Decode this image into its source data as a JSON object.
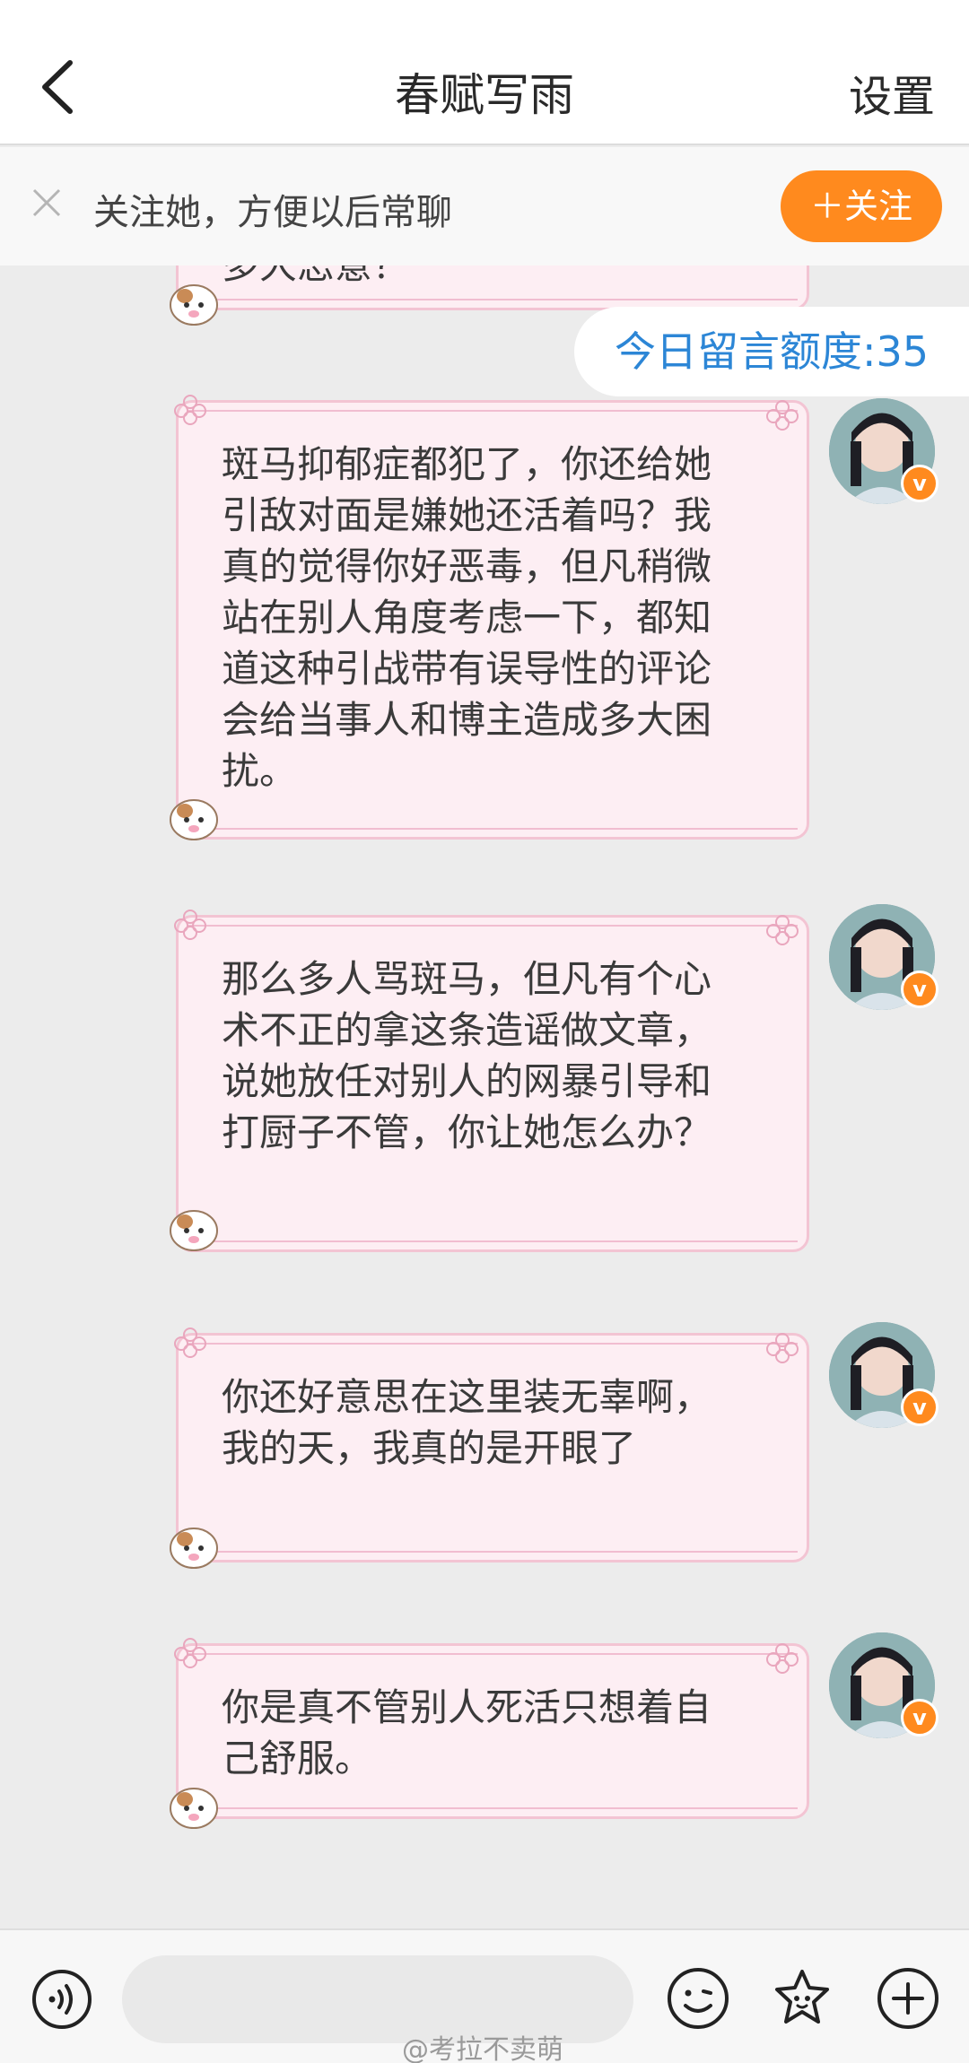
{
  "header": {
    "title": "春赋写雨",
    "settings_label": "设置"
  },
  "follow_bar": {
    "text": "关注她，方便以后常聊",
    "button_label": "＋关注"
  },
  "quota": {
    "text": "今日留言额度:35"
  },
  "messages": [
    {
      "text": "多大恶意？"
    },
    {
      "text": "斑马抑郁症都犯了，你还给她引敌对面是嫌她还活着吗？我真的觉得你好恶毒，但凡稍微站在别人角度考虑一下，都知道这种引战带有误导性的评论会给当事人和博主造成多大困扰。"
    },
    {
      "text": "那么多人骂斑马，但凡有个心术不正的拿这条造谣做文章，说她放任对别人的网暴引导和打厨子不管，你让她怎么办？"
    },
    {
      "text": "你还好意思在这里装无辜啊，我的天，我真的是开眼了"
    },
    {
      "text": "你是真不管别人死活只想着自己舒服。"
    }
  ],
  "verified_badge": "v",
  "input": {
    "value": "",
    "placeholder": ""
  },
  "watermark": "@考拉不卖萌",
  "colors": {
    "accent": "#ff8a1e",
    "quota_text": "#2c86d6",
    "bubble_bg": "#fdeef3",
    "bubble_border": "#f3c4d3"
  }
}
